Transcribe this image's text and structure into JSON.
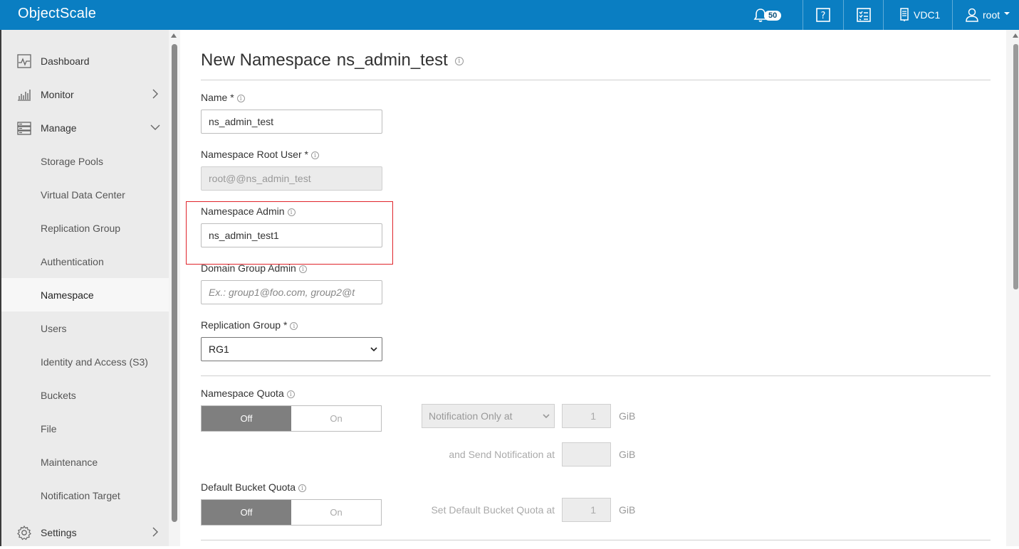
{
  "app": {
    "title": "ObjectScale"
  },
  "topbar": {
    "notifications": {
      "icon": "bell-icon",
      "count": "50"
    },
    "help": {
      "icon": "help-icon"
    },
    "tasks": {
      "icon": "checklist-icon"
    },
    "vdc": {
      "icon": "server-icon",
      "label": "VDC1"
    },
    "user": {
      "icon": "user-icon",
      "label": "root"
    }
  },
  "sidebar": {
    "items": [
      {
        "label": "Dashboard",
        "icon": "dashboard-icon"
      },
      {
        "label": "Monitor",
        "icon": "monitor-icon"
      },
      {
        "label": "Manage",
        "icon": "manage-icon"
      },
      {
        "label": "Storage Pools"
      },
      {
        "label": "Virtual Data Center"
      },
      {
        "label": "Replication Group"
      },
      {
        "label": "Authentication"
      },
      {
        "label": "Namespace"
      },
      {
        "label": "Users"
      },
      {
        "label": "Identity and Access (S3)"
      },
      {
        "label": "Buckets"
      },
      {
        "label": "File"
      },
      {
        "label": "Maintenance"
      },
      {
        "label": "Notification Target"
      },
      {
        "label": "Settings",
        "icon": "gear-icon"
      }
    ]
  },
  "page": {
    "title": "New Namespace",
    "namespace_name": "ns_admin_test"
  },
  "form": {
    "name": {
      "label": "Name *",
      "value": "ns_admin_test"
    },
    "root_user": {
      "label": "Namespace Root User *",
      "value": "root@@ns_admin_test"
    },
    "ns_admin": {
      "label": "Namespace Admin",
      "value": "ns_admin_test1"
    },
    "domain_group_admin": {
      "label": "Domain Group Admin",
      "placeholder": "Ex.: group1@foo.com, group2@t"
    },
    "replication_group": {
      "label": "Replication Group *",
      "value": "RG1"
    },
    "namespace_quota": {
      "label": "Namespace Quota",
      "off_label": "Off",
      "on_label": "On",
      "mode": "Notification Only at",
      "limit_value": "1",
      "unit": "GiB",
      "notify_label": "and Send Notification at",
      "notify_value": "",
      "notify_unit": "GiB"
    },
    "bucket_quota": {
      "label": "Default Bucket Quota",
      "off_label": "Off",
      "on_label": "On",
      "set_label": "Set Default Bucket Quota at",
      "value": "1",
      "unit": "GiB"
    }
  }
}
